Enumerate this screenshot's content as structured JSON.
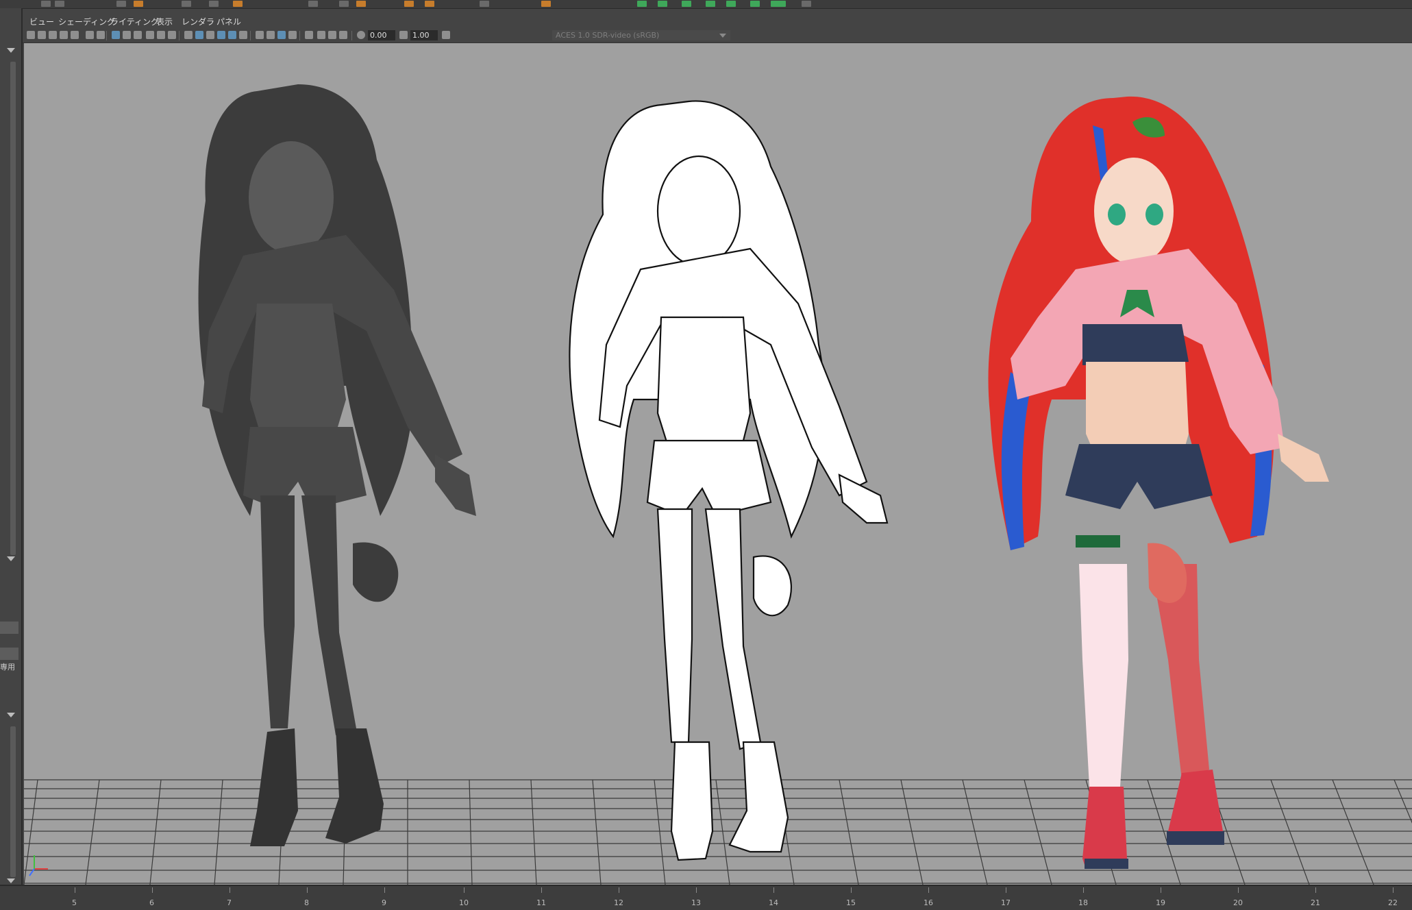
{
  "menubar": {
    "items": [
      "ビュー",
      "シェーディング",
      "ライティング",
      "表示",
      "レンダラ",
      "パネル"
    ]
  },
  "toolbar": {
    "exposure_value": "0.00",
    "gamma_value": "1.00",
    "color_space": "ACES 1.0 SDR-video (sRGB)"
  },
  "sidebar": {
    "truncated_label": "専用"
  },
  "timeline": {
    "ticks": [
      "5",
      "6",
      "7",
      "8",
      "9",
      "10",
      "11",
      "12",
      "13",
      "14",
      "15",
      "16",
      "17",
      "18",
      "19",
      "20",
      "21",
      "22"
    ]
  },
  "viewport": {
    "background_color": "#a0a0a0",
    "grid_color": "#3a3a3a",
    "models": [
      {
        "name": "grey-shaded-model",
        "shading": "default material",
        "color": "#4a4a4a"
      },
      {
        "name": "wireframe-outline-model",
        "shading": "toon outline",
        "color": "#ffffff"
      },
      {
        "name": "textured-model",
        "shading": "textured",
        "color": "#d93a35"
      }
    ]
  },
  "colors": {
    "ui_dark": "#444444",
    "ui_darker": "#2b2b2b",
    "highlight": "#5d8fb5",
    "hair_red": "#e0302a",
    "hair_blue": "#2a5bd0",
    "jacket_pink": "#f3a6b4",
    "shorts_navy": "#2f3c5a"
  }
}
